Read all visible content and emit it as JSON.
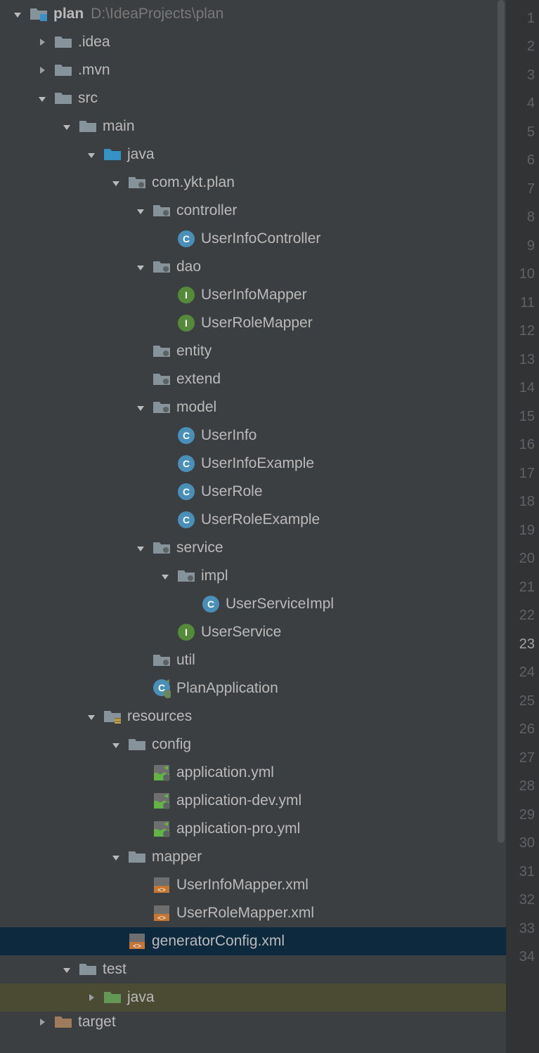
{
  "root": {
    "name": "plan",
    "path": "D:\\IdeaProjects\\plan"
  },
  "nodes": {
    "idea": ".idea",
    "mvn": ".mvn",
    "src": "src",
    "main": "main",
    "java": "java",
    "pkg": "com.ykt.plan",
    "controller": "controller",
    "userInfoController": "UserInfoController",
    "dao": "dao",
    "userInfoMapper": "UserInfoMapper",
    "userRoleMapper": "UserRoleMapper",
    "entity": "entity",
    "extend": "extend",
    "model": "model",
    "userInfo": "UserInfo",
    "userInfoExample": "UserInfoExample",
    "userRole": "UserRole",
    "userRoleExample": "UserRoleExample",
    "service": "service",
    "impl": "impl",
    "userServiceImpl": "UserServiceImpl",
    "userService": "UserService",
    "util": "util",
    "planApplication": "PlanApplication",
    "resources": "resources",
    "config": "config",
    "appYml": "application.yml",
    "appDevYml": "application-dev.yml",
    "appProYml": "application-pro.yml",
    "mapper": "mapper",
    "userInfoMapperXml": "UserInfoMapper.xml",
    "userRoleMapperXml": "UserRoleMapper.xml",
    "generatorConfig": "generatorConfig.xml",
    "test": "test",
    "testJava": "java",
    "target": "target"
  },
  "lineNumbers": [
    "1",
    "2",
    "3",
    "4",
    "5",
    "6",
    "7",
    "8",
    "9",
    "10",
    "11",
    "12",
    "13",
    "14",
    "15",
    "16",
    "17",
    "18",
    "19",
    "20",
    "21",
    "22",
    "23",
    "24",
    "25",
    "26",
    "27",
    "28",
    "29",
    "30",
    "31",
    "32",
    "33",
    "34"
  ],
  "currentLine": "23"
}
